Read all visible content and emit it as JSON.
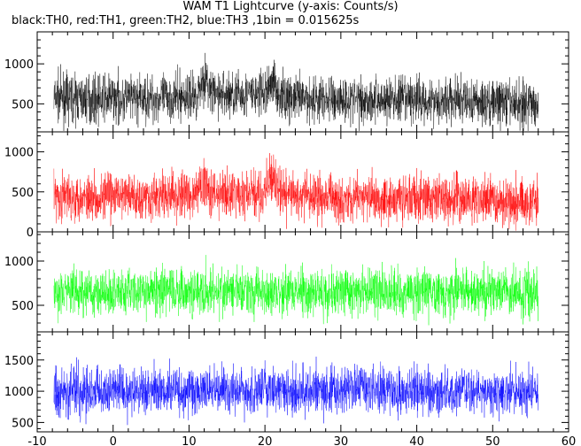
{
  "page": {
    "title": "WAM T1 Lightcurve (y-axis: Counts/s)",
    "subtitle": "black:TH0, red:TH1, green:TH2, blue:TH3 ,1bin = 0.015625s"
  },
  "chart_data": {
    "type": "line",
    "title": "WAM T1 Lightcurve (y-axis: Counts/s)",
    "subtitle": "black:TH0, red:TH1, green:TH2, blue:TH3 ,1bin = 0.015625s",
    "xlabel": "",
    "ylabel": "",
    "xlim": [
      -10,
      60
    ],
    "x_ticks": [
      -10,
      0,
      10,
      20,
      30,
      40,
      50,
      60
    ],
    "bin_seconds": 0.015625,
    "data_x_range": [
      -7.8,
      56
    ],
    "grid": false,
    "legend": "none",
    "panels": [
      {
        "name": "TH0",
        "color": "#000000",
        "ylim": [
          150,
          1400
        ],
        "y_ticks": [
          500,
          1000
        ],
        "x": [
          -8,
          -4,
          0,
          4,
          8,
          11,
          12,
          13,
          16,
          20,
          21,
          22,
          25,
          30,
          35,
          40,
          45,
          50,
          56
        ],
        "y": [
          580,
          560,
          570,
          560,
          580,
          600,
          850,
          620,
          620,
          620,
          800,
          590,
          560,
          560,
          550,
          550,
          540,
          520,
          500
        ]
      },
      {
        "name": "TH1",
        "color": "#ff0000",
        "ylim": [
          0,
          1250
        ],
        "y_ticks": [
          0,
          500,
          1000
        ],
        "x": [
          -8,
          -4,
          0,
          4,
          8,
          11,
          12,
          13,
          16,
          20,
          21,
          22,
          25,
          30,
          35,
          40,
          45,
          50,
          56
        ],
        "y": [
          450,
          440,
          450,
          440,
          450,
          470,
          650,
          480,
          460,
          480,
          720,
          470,
          440,
          430,
          420,
          420,
          410,
          400,
          380
        ]
      },
      {
        "name": "TH2",
        "color": "#00ff00",
        "ylim": [
          200,
          1330
        ],
        "y_ticks": [
          500,
          1000
        ],
        "x": [
          -8,
          0,
          10,
          20,
          30,
          40,
          50,
          56
        ],
        "y": [
          650,
          650,
          660,
          660,
          650,
          650,
          645,
          640
        ]
      },
      {
        "name": "TH3",
        "color": "#0000ff",
        "ylim": [
          350,
          1950
        ],
        "y_ticks": [
          500,
          1000,
          1500
        ],
        "x": [
          -8,
          0,
          10,
          20,
          30,
          33,
          35,
          40,
          50,
          56
        ],
        "y": [
          1020,
          1010,
          1015,
          1010,
          1005,
          1050,
          1005,
          1000,
          1000,
          990
        ]
      }
    ]
  }
}
